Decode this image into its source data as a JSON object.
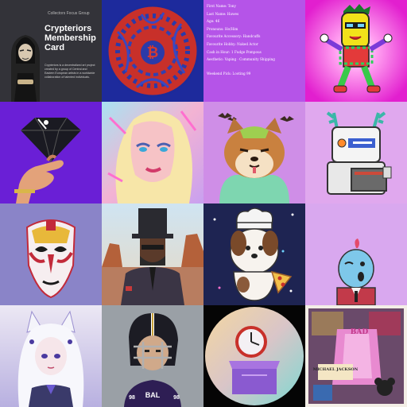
{
  "tiles": [
    {
      "name": "crypteriors-card",
      "background": "#2d2d33",
      "small_label": "Collectors Focus Group",
      "title": "Crypteriors Membership Card",
      "description": "Crypteriors is a decentralized art project created by a group of Central and Eastern European artists in a worldwide collaboration of talented individuals."
    },
    {
      "name": "bitcoin-coin",
      "background": "#1d2a9c",
      "icon": "bitcoin-icon"
    },
    {
      "name": "character-traits",
      "background": "#b554e8",
      "traits": [
        "First Name: Tony",
        "Last Name: Hawes",
        "Age: 46",
        "Pronouns: He/Him",
        "Favourite Accessory: Handcuffs",
        "Favourite Hobby: Naked Actor",
        "Cash in Hour: 1 Fudge Pompous",
        "Aesthetic: Vaping · Community Shipping",
        "Weekend Pick: Looting 99"
      ]
    },
    {
      "name": "pixel-banana-character",
      "background": "#ee2ad7"
    },
    {
      "name": "black-diamond-hand",
      "background": "#6a1fd6"
    },
    {
      "name": "pastel-portrait",
      "background": "#f0b4d8"
    },
    {
      "name": "shiba-dog-bats",
      "background": "#cf8ee7"
    },
    {
      "name": "robot-antlers",
      "background": "#e0a8ee"
    },
    {
      "name": "opera-mask",
      "background": "#8a84c8"
    },
    {
      "name": "top-hat-desert-man",
      "background": "#b87d60"
    },
    {
      "name": "chef-dog-pizza",
      "background": "#1e2452"
    },
    {
      "name": "blue-dino-figure",
      "background": "#d9a8ef"
    },
    {
      "name": "anime-fox-girl",
      "background": "#ece8f4"
    },
    {
      "name": "football-player",
      "background": "#9aa0a6",
      "jersey_text": "BAL",
      "number": "98"
    },
    {
      "name": "clock-box",
      "background": "#050505"
    },
    {
      "name": "michael-jackson-collage",
      "background": "#f3eee6",
      "banner_text": "MICHAEL JACKSON",
      "sub_text": "BAD"
    }
  ]
}
